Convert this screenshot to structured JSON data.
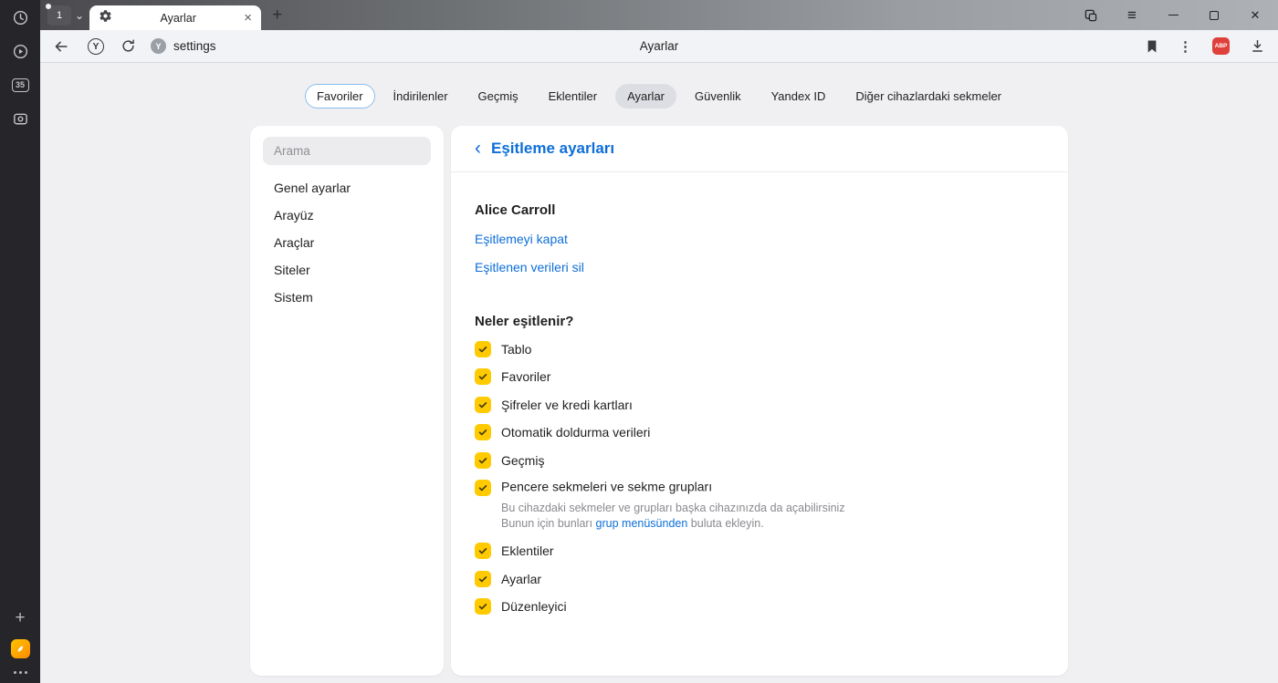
{
  "colors": {
    "accent_blue": "#0d6ed9",
    "checkbox_yellow": "#ffcb00",
    "abp_red": "#e0403a",
    "logo_orange": "#ff9e00",
    "rail_dark": "#26262a"
  },
  "rail": {
    "tabs_count_badge": "35"
  },
  "tabbar": {
    "mini_tab_count": "1",
    "chevron_down": "⌄",
    "active_tab_title": "Ayarlar",
    "close_tab_glyph": "×",
    "new_tab_glyph": "+",
    "hamburger_glyph": "≡",
    "close_window_glyph": "✕"
  },
  "toolbar": {
    "home_letter": "Y",
    "favicon_letter": "Y",
    "address": "settings",
    "page_title": "Ayarlar",
    "kebab_glyph": "⋮",
    "abp_label": "ABP"
  },
  "nav": {
    "tabs": [
      {
        "label": "Favoriler",
        "style": "outlined"
      },
      {
        "label": "İndirilenler",
        "style": "plain"
      },
      {
        "label": "Geçmiş",
        "style": "plain"
      },
      {
        "label": "Eklentiler",
        "style": "plain"
      },
      {
        "label": "Ayarlar",
        "style": "active"
      },
      {
        "label": "Güvenlik",
        "style": "plain"
      },
      {
        "label": "Yandex ID",
        "style": "plain"
      },
      {
        "label": "Diğer cihazlardaki sekmeler",
        "style": "plain"
      }
    ]
  },
  "sidebar": {
    "search_placeholder": "Arama",
    "items": [
      "Genel ayarlar",
      "Arayüz",
      "Araçlar",
      "Siteler",
      "Sistem"
    ]
  },
  "sync": {
    "back_glyph": "‹",
    "title": "Eşitleme ayarları",
    "account_name": "Alice Carroll",
    "link_disable": "Eşitlemeyi kapat",
    "link_delete": "Eşitlenen verileri sil",
    "section_title": "Neler eşitlenir?",
    "items": [
      {
        "label": "Tablo",
        "checked": true
      },
      {
        "label": "Favoriler",
        "checked": true
      },
      {
        "label": "Şifreler ve kredi kartları",
        "checked": true
      },
      {
        "label": "Otomatik doldurma verileri",
        "checked": true
      },
      {
        "label": "Geçmiş",
        "checked": true
      },
      {
        "label": "Pencere sekmeleri ve sekme grupları",
        "checked": true
      },
      {
        "label": "Eklentiler",
        "checked": true
      },
      {
        "label": "Ayarlar",
        "checked": true
      },
      {
        "label": "Düzenleyici",
        "checked": true
      }
    ],
    "note": {
      "line1": "Bu cihazdaki sekmeler ve grupları başka cihazınızda da açabilirsiniz",
      "line2_before": "Bunun için bunları ",
      "line2_link": "grup menüsünden",
      "line2_after": " buluta ekleyin."
    }
  }
}
